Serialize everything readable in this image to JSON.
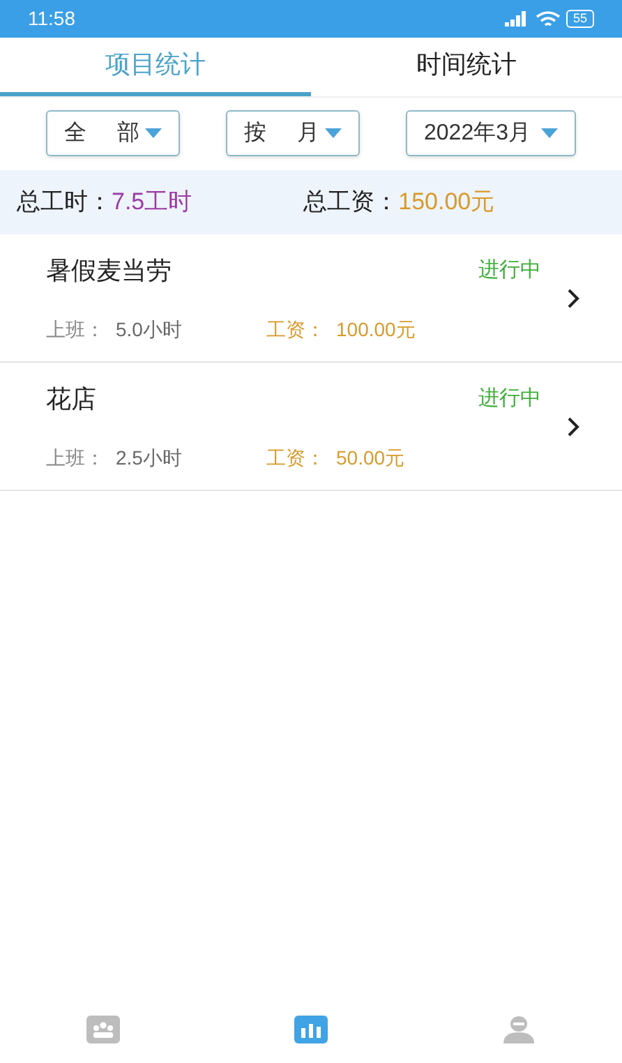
{
  "status_bar": {
    "time": "11:58",
    "battery": "55"
  },
  "tabs": [
    {
      "label": "项目统计",
      "selected": true
    },
    {
      "label": "时间统计",
      "selected": false
    }
  ],
  "filters": [
    {
      "label_1": "全",
      "label_2": "部"
    },
    {
      "label_1": "按",
      "label_2": "月"
    },
    {
      "label_1": "2022年3月"
    }
  ],
  "summary": {
    "hours_label": "总工时：",
    "hours_value": "7.5工时",
    "wage_label": "总工资：",
    "wage_value": "150.00元"
  },
  "projects": [
    {
      "name": "暑假麦当劳",
      "status": "进行中",
      "hours_label": "上班：",
      "hours": "5.0小时",
      "wage_label": "工资：",
      "wage": "100.00元"
    },
    {
      "name": "花店",
      "status": "进行中",
      "hours_label": "上班：",
      "hours": "2.5小时",
      "wage_label": "工资：",
      "wage": "50.00元"
    }
  ],
  "bottom_nav": [
    {
      "kind": "team",
      "selected": false
    },
    {
      "kind": "stats",
      "selected": true
    },
    {
      "kind": "person",
      "selected": false
    }
  ]
}
